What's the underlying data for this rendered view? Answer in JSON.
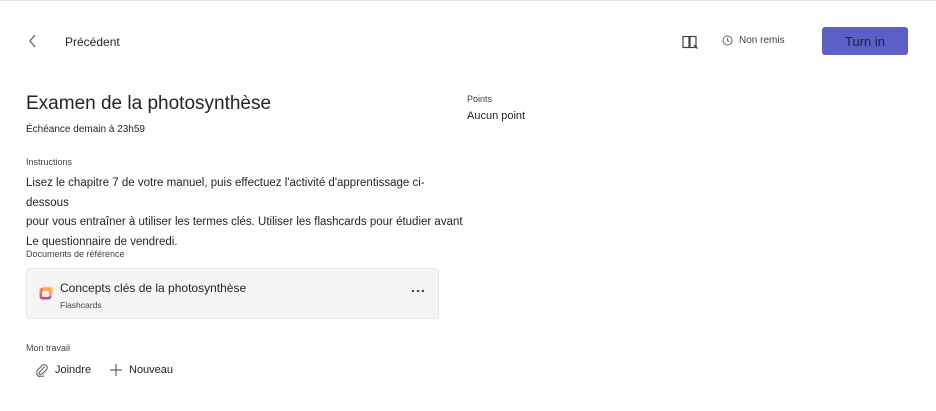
{
  "header": {
    "back_label": "Précédent",
    "status_label": "Non remis",
    "turn_in_label": "Turn in"
  },
  "assignment": {
    "title": "Examen de la photosynthèse",
    "due": "Échéance demain à 23h59",
    "points_label": "Points",
    "points_value": "Aucun point",
    "instructions_label": "Instructions",
    "instructions_lines": [
      "Lisez le chapitre 7 de votre manuel, puis effectuez l'activité d'apprentissage ci-dessous",
      "pour vous entraîner à utiliser les termes clés. Utiliser les flashcards pour étudier avant",
      "Le questionnaire de vendredi."
    ]
  },
  "reference": {
    "label": "Documents de référence",
    "document": {
      "title": "Concepts clés de la photosynthèse",
      "type": "Flashcards"
    }
  },
  "my_work": {
    "label": "Mon travail",
    "attach_label": "Joindre",
    "new_label": "Nouveau"
  },
  "icons": {
    "back": "chevron-left-icon",
    "reader": "immersive-reader-icon",
    "status": "clock-icon",
    "document": "flashcards-app-icon",
    "more": "more-horizontal-icon",
    "attach": "paperclip-icon",
    "new": "plus-icon"
  },
  "colors": {
    "accent": "#5b5fc7",
    "card_background": "#f5f5f5"
  }
}
